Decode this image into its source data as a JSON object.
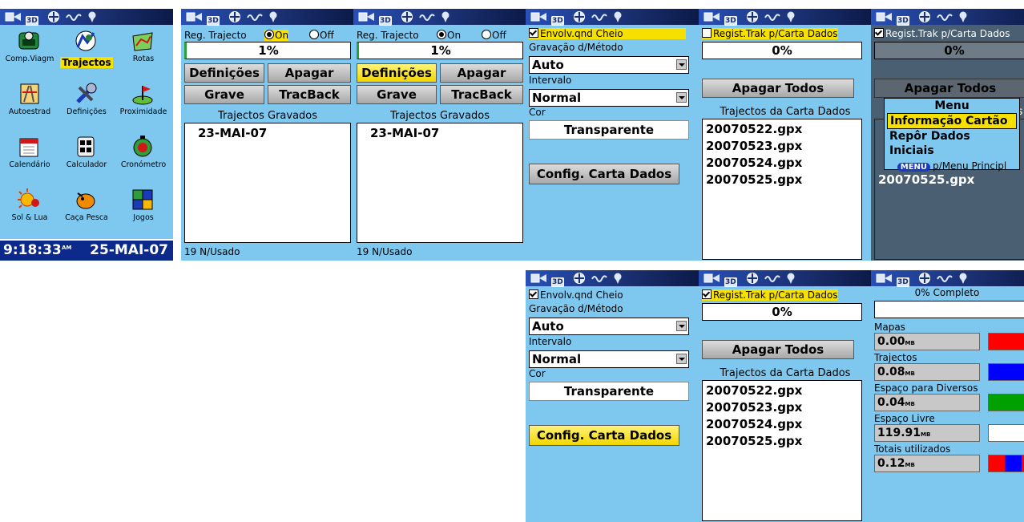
{
  "colors": {
    "screen_bg": "#7ec8f0",
    "highlight": "#f5e000",
    "status_bar": "#1a2f70"
  },
  "status_icons": [
    "rectangle-arrow-icon",
    "3d-map-icon",
    "compass-icon",
    "track-wave-icon",
    "map-pin-icon"
  ],
  "status_3d": "3D",
  "main_menu": {
    "items": [
      {
        "label": "Comp.Viagm",
        "icon": "trip-computer-icon"
      },
      {
        "label": "Trajectos",
        "icon": "tracks-icon",
        "selected": true
      },
      {
        "label": "Rotas",
        "icon": "routes-icon"
      },
      {
        "label": "Autoestrad",
        "icon": "highway-icon"
      },
      {
        "label": "Definições",
        "icon": "settings-icon"
      },
      {
        "label": "Proximidade",
        "icon": "proximity-icon"
      },
      {
        "label": "Calendário",
        "icon": "calendar-icon"
      },
      {
        "label": "Calculador",
        "icon": "calculator-icon"
      },
      {
        "label": "Cronómetro",
        "icon": "stopwatch-icon"
      },
      {
        "label": "Sol & Lua",
        "icon": "sun-moon-icon"
      },
      {
        "label": "Caça Pesca",
        "icon": "hunt-fish-icon"
      },
      {
        "label": "Jogos",
        "icon": "games-icon"
      }
    ],
    "time": "9:18:33",
    "time_suffix": "AM",
    "date": "25-MAI-07"
  },
  "tracks": {
    "reg_label": "Reg. Trajecto",
    "on": "On",
    "off": "Off",
    "percent": "1%",
    "definicoes": "Definições",
    "apagar": "Apagar",
    "grave": "Grave",
    "tracback": "TracBack",
    "saved_header": "Trajectos Gravados",
    "saved_item": "23-MAI-07",
    "footer": "19 N/Usado"
  },
  "setup": {
    "wrap_label": "Envolv.qnd Cheio",
    "method_label": "Gravação d/Método",
    "method_value": "Auto",
    "interval_label": "Intervalo",
    "interval_value": "Normal",
    "color_label": "Cor",
    "color_value": "Transparente",
    "card_button": "Config. Carta Dados"
  },
  "card": {
    "reg_label": "Regist.Trak p/Carta Dados",
    "percent": "0%",
    "delete_all": "Apagar Todos",
    "list_header": "Trajectos da Carta Dados",
    "files": [
      "20070522.gpx",
      "20070523.gpx",
      "20070524.gpx",
      "20070525.gpx"
    ]
  },
  "menu_popup": {
    "title": "Menu",
    "items": [
      "Informação Cartão",
      "Repôr Dados Iniciais"
    ],
    "hint_key": "MENU",
    "hint": "p/Menu Principl"
  },
  "card_info": {
    "complete": "0% Completo",
    "rows": [
      {
        "label": "Mapas",
        "value": "0.00",
        "unit": "MB",
        "color": "#ff0000"
      },
      {
        "label": "Trajectos",
        "value": "0.08",
        "unit": "MB",
        "color": "#0000ff"
      },
      {
        "label": "Espaço para Diversos",
        "value": "0.04",
        "unit": "MB",
        "color": "#00a000"
      },
      {
        "label": "Espaço Livre",
        "value": "119.91",
        "unit": "MB",
        "color": "#ffffff"
      },
      {
        "label": "Totais utilizados",
        "value": "0.12",
        "unit": "MB",
        "color": "multi"
      }
    ]
  }
}
